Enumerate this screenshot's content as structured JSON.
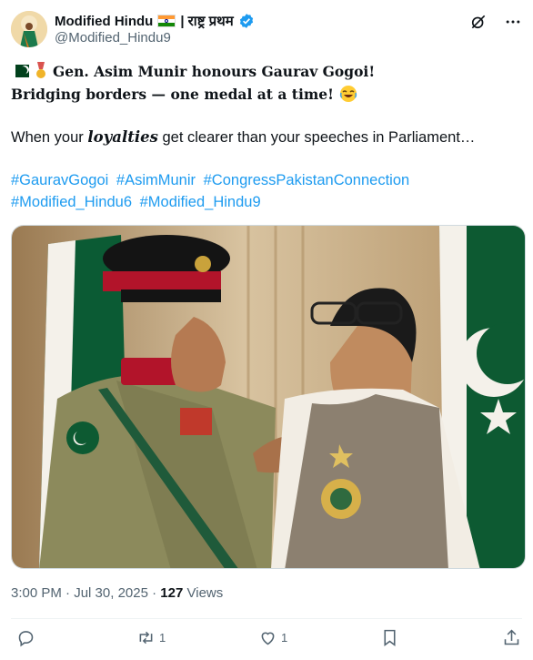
{
  "author": {
    "display_name": "Modified Hindu",
    "tagline": "| राष्ट्र प्रथम",
    "handle": "@Modified_Hindu9"
  },
  "post": {
    "line1": "Gen. Asim Munir honours Gaurav Gogoi!",
    "line2": "Bridging borders — one medal at a time!",
    "line3_prefix": "When your",
    "line3_keyword": "loyalties",
    "line3_suffix": "get clearer than your speeches in Parliament…",
    "hashtags_row1": [
      "#GauravGogoi",
      "#AsimMunir",
      "#CongressPakistanConnection"
    ],
    "hashtags_row2": [
      "#Modified_Hindu6",
      "#Modified_Hindu9"
    ]
  },
  "meta": {
    "time": "3:00 PM",
    "separator": "·",
    "date": "Jul 30, 2025",
    "views_count": "127",
    "views_label": "Views"
  },
  "actions": {
    "reply_count": "",
    "repost_count": "1",
    "like_count": "1"
  },
  "icons": {
    "grok": "grok-icon",
    "more": "more-icon",
    "verified": "verified-badge-icon",
    "reply": "reply-icon",
    "repost": "repost-icon",
    "like": "heart-icon",
    "bookmark": "bookmark-icon",
    "share": "share-icon"
  },
  "colors": {
    "link": "#1d9bf0",
    "muted": "#536471",
    "text": "#0f1419",
    "verified": "#1d9bf0"
  }
}
